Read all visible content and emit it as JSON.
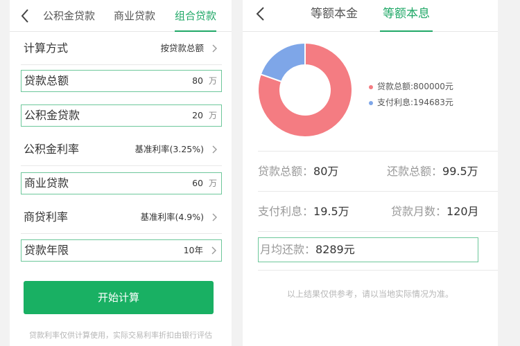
{
  "left": {
    "tabs": [
      "公积金贷款",
      "商业贷款",
      "组合贷款"
    ],
    "active_tab": 2,
    "rows": [
      {
        "label": "计算方式",
        "value": "按贷款总额"
      },
      {
        "label": "贷款总额",
        "value": "80",
        "unit": "万"
      },
      {
        "label": "公积金贷款",
        "value": "20",
        "unit": "万"
      },
      {
        "label": "公积金利率",
        "value": "基准利率(3.25%)"
      },
      {
        "label": "商业贷款",
        "value": "60",
        "unit": "万"
      },
      {
        "label": "商贷利率",
        "value": "基准利率(4.9%)"
      },
      {
        "label": "贷款年限",
        "value": "10年"
      }
    ],
    "button": "开始计算",
    "footnote": "贷款利率仅供计算使用，实际交易利率折扣由银行评估"
  },
  "right": {
    "tabs": [
      "等额本金",
      "等额本息"
    ],
    "active_tab": 1,
    "legend": [
      {
        "label": "贷款总额:800000元",
        "color": "#f47c82"
      },
      {
        "label": "支付利息:194683元",
        "color": "#7ea6e8"
      }
    ],
    "donut": {
      "principal": 800000,
      "interest": 194683
    },
    "stats": [
      {
        "label": "贷款总额：",
        "value": "80万"
      },
      {
        "label": "还款总额：",
        "value": "99.5万"
      },
      {
        "label": "支付利息：",
        "value": "19.5万"
      },
      {
        "label": "贷款月数：",
        "value": "120月"
      },
      {
        "label": "月均还款：",
        "value": "8289元"
      }
    ],
    "footnote": "以上结果仅供参考，请以当地实际情况为准。"
  },
  "colors": {
    "accent": "#20a867",
    "button": "#19b063",
    "principal": "#f47c82",
    "interest": "#7ea6e8"
  }
}
